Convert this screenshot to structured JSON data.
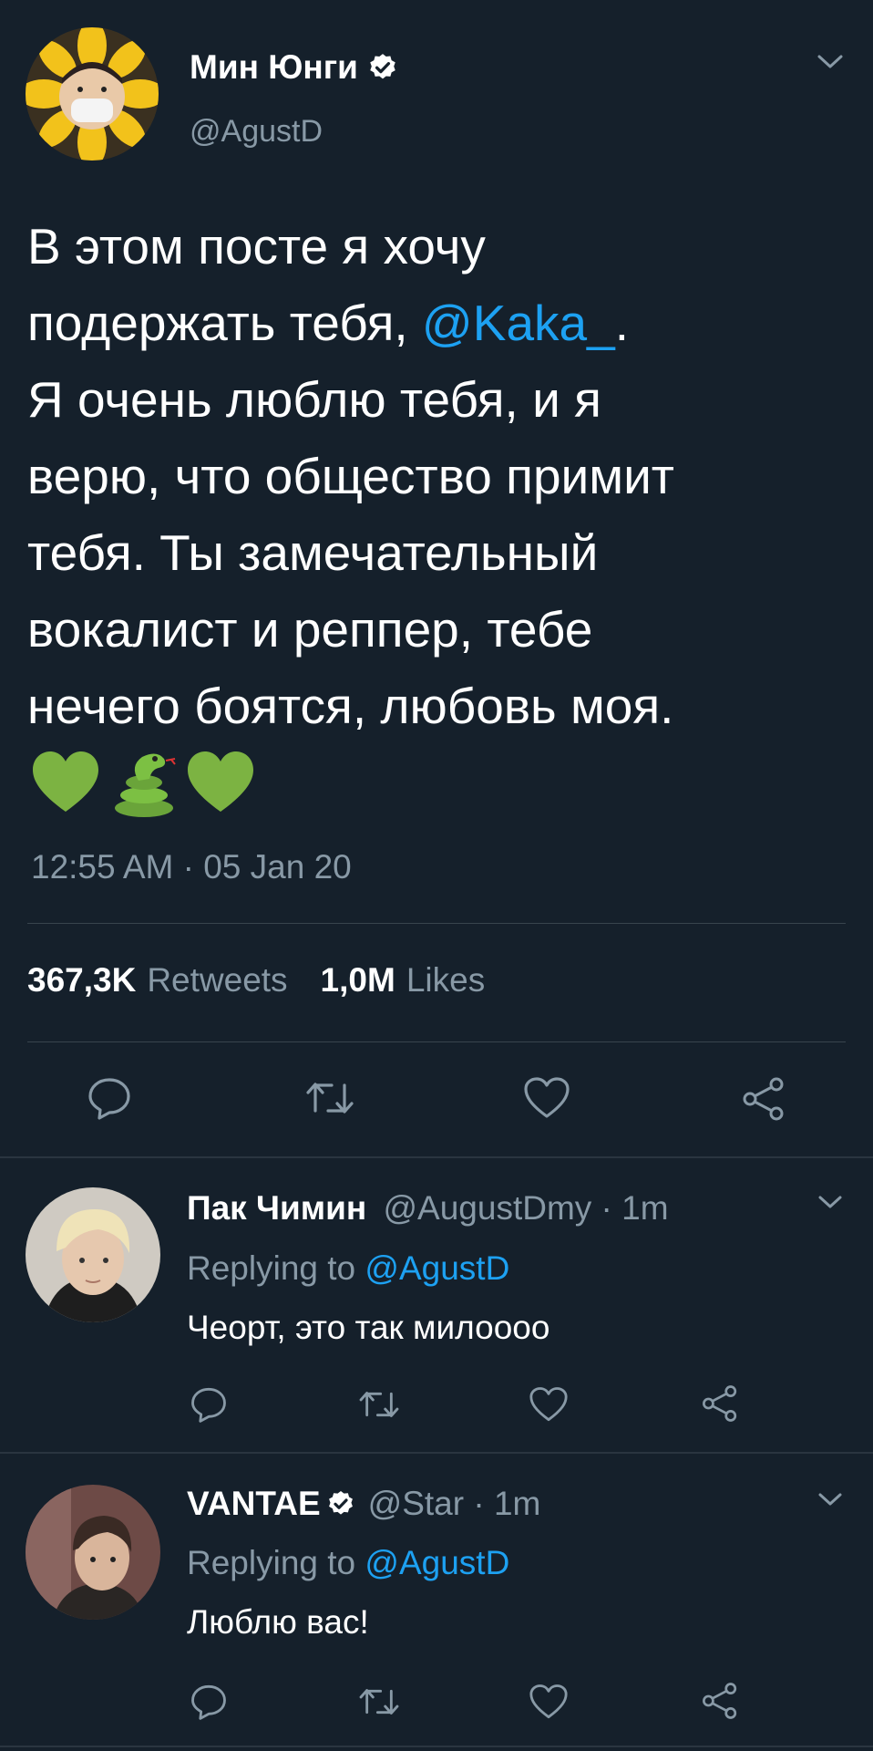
{
  "main_tweet": {
    "display_name": "Мин Юнги",
    "handle": "@AgustD",
    "text_lines": [
      {
        "text": "В этом посте я хочу"
      },
      {
        "pre": "подержать тебя, ",
        "mention": "@Kaka_",
        "post": "."
      },
      {
        "text": "Я очень люблю тебя, и я"
      },
      {
        "text": "верю, что общество примит"
      },
      {
        "text": "тебя. Ты замечательный"
      },
      {
        "text": "вокалист и реппер, тебе"
      },
      {
        "text": "нечего боятся, любовь моя."
      }
    ],
    "emojis": "💚🐍💚",
    "timestamp": "12:55 AM · 05 Jan 20",
    "retweets_count": "367,3K",
    "retweets_label": "Retweets",
    "likes_count": "1,0M",
    "likes_label": "Likes"
  },
  "replies": [
    {
      "display_name": "Пак Чимин",
      "handle_time": "@AugustDmy · 1m",
      "replying_prefix": "Replying to ",
      "replying_to": "@AgustD",
      "text": "Чеорт, это так милоооо"
    },
    {
      "display_name": "VANTAE",
      "handle_time": "@Star · 1m",
      "replying_prefix": "Replying to ",
      "replying_to": "@AgustD",
      "text": "Люблю вас!"
    }
  ],
  "colors": {
    "background": "#15202b",
    "muted": "#8899a6",
    "link": "#1da1f2",
    "divider": "#38444d"
  },
  "icons": [
    "verified-icon",
    "chevron-down-icon",
    "reply-icon",
    "retweet-icon",
    "like-icon",
    "share-icon"
  ]
}
